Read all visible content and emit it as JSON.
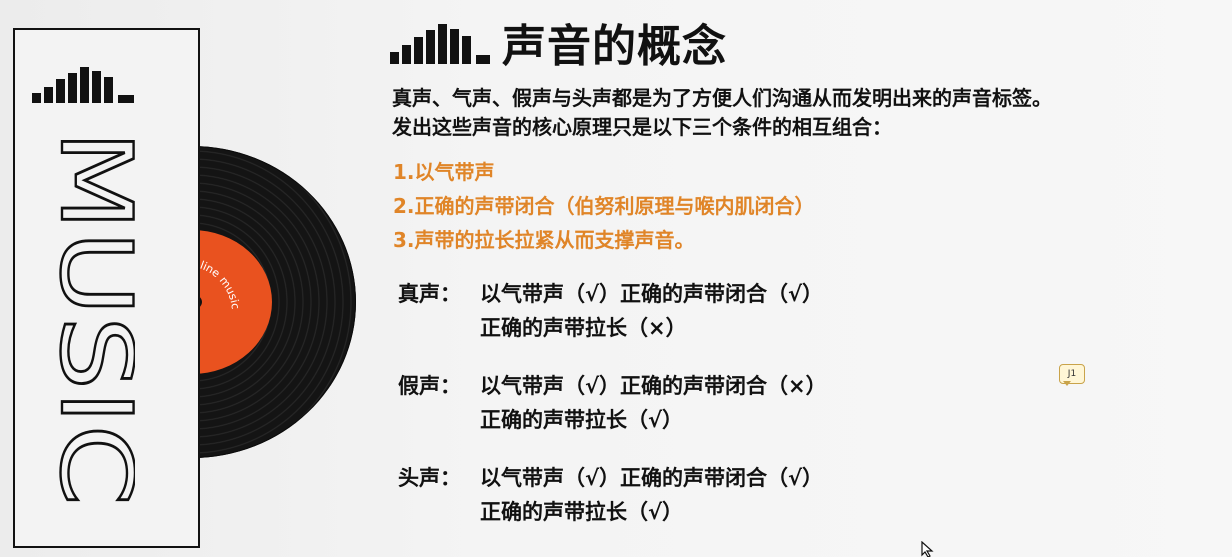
{
  "decoration": {
    "panel_word": "MUSIC",
    "vinyl_label_text": "Music Online music"
  },
  "slide": {
    "title": "声音的概念",
    "intro": [
      "真声、气声、假声与头声都是为了方便人们沟通从而发明出来的声音标签。",
      "发出这些声音的核心原理只是以下三个条件的相互组合："
    ],
    "conditions": [
      "1.以气带声",
      "2.正确的声带闭合（伯努利原理与喉内肌闭合）",
      "3.声带的拉长拉紧从而支撑声音。"
    ],
    "voices": [
      {
        "name": "真声：",
        "line1": "以气带声（√）正确的声带闭合（√）",
        "line2": "正确的声带拉长（×）"
      },
      {
        "name": "假声：",
        "line1": "以气带声（√）正确的声带闭合（×）",
        "line2": "正确的声带拉长（√）"
      },
      {
        "name": "头声：",
        "line1": "以气带声（√）正确的声带闭合（√）",
        "line2": "正确的声带拉长（√）"
      }
    ]
  },
  "comment": {
    "label": "J1"
  },
  "colors": {
    "accent_orange": "#e08528",
    "vinyl_label": "#e9521f",
    "text": "#111111"
  },
  "icons": {
    "title_marker": "equalizer-bars-icon",
    "panel_marker": "equalizer-bars-icon",
    "comment": "comment-bubble-icon",
    "cursor": "mouse-cursor-icon"
  }
}
